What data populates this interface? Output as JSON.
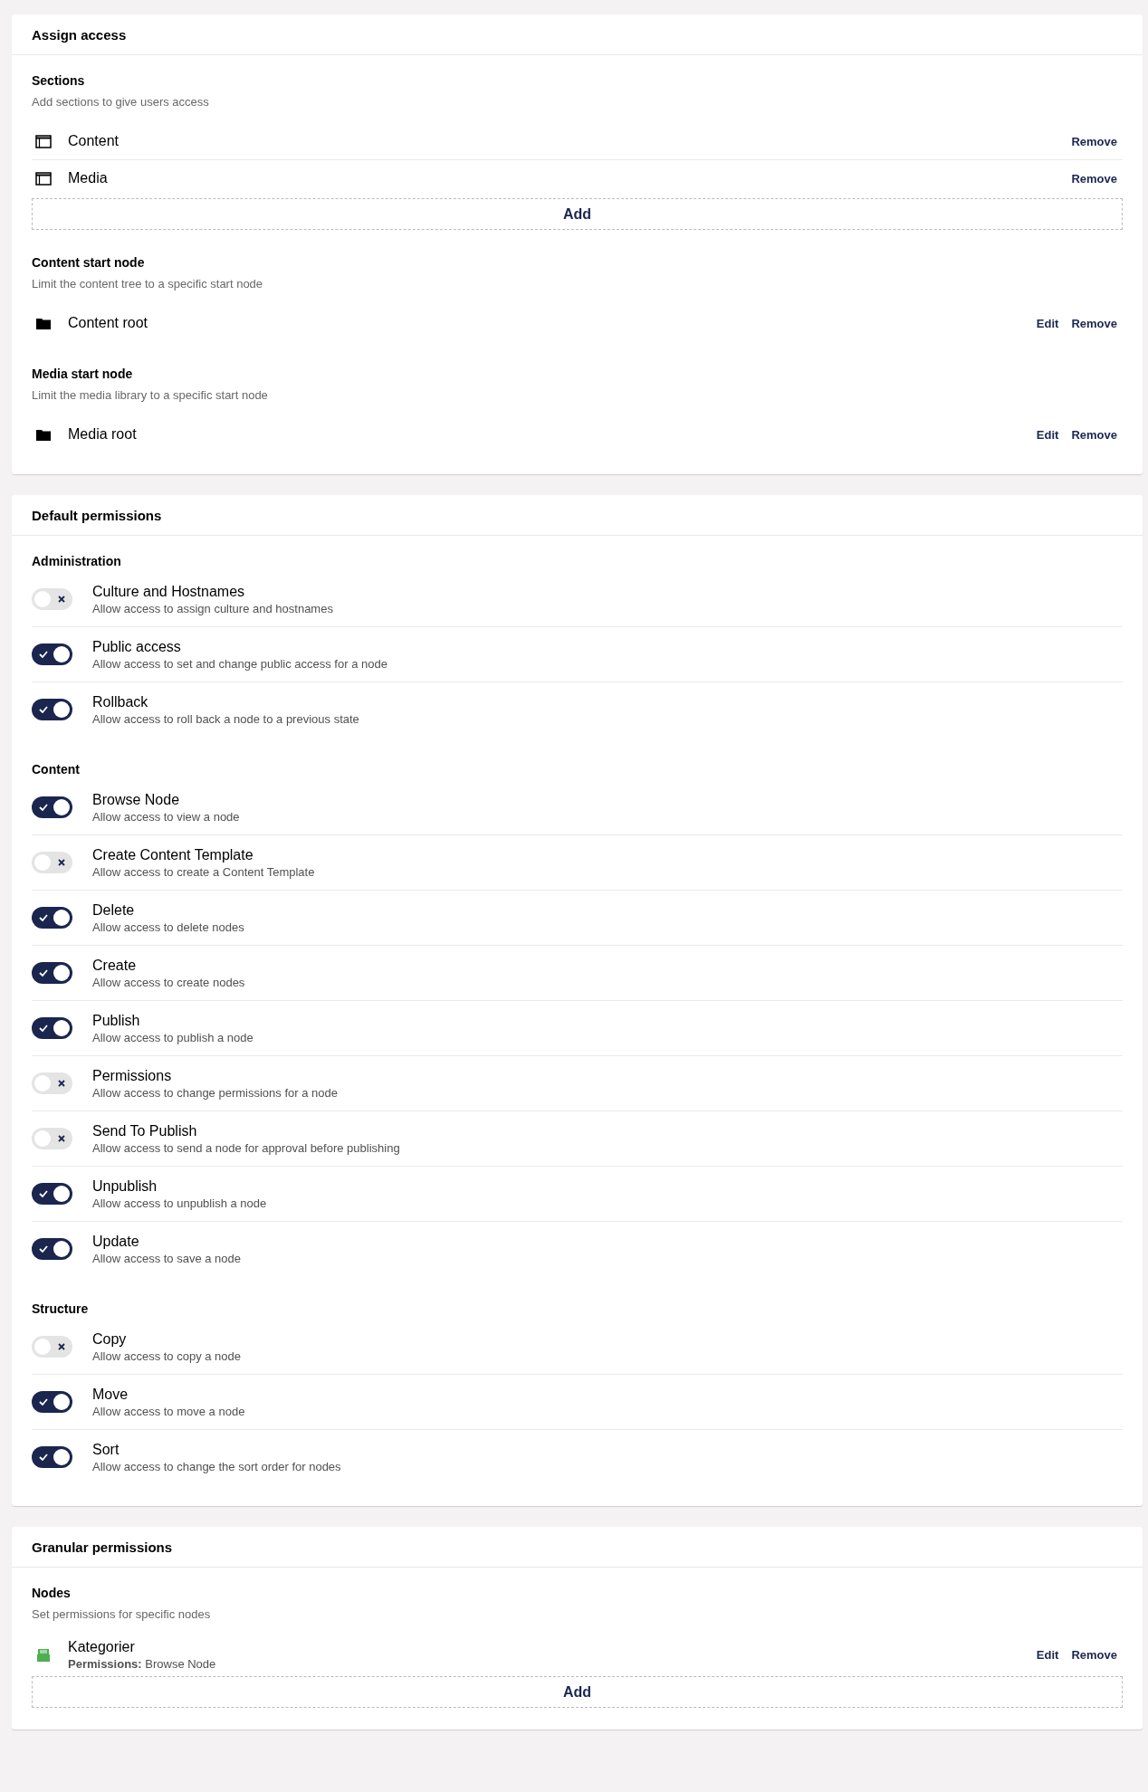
{
  "cards": [
    {
      "title": "Assign access",
      "blocks": [
        {
          "kind": "sections",
          "label": "Sections",
          "description": "Add sections to give users access",
          "items": [
            {
              "name": "Content",
              "actions": [
                "Remove"
              ]
            },
            {
              "name": "Media",
              "actions": [
                "Remove"
              ]
            }
          ],
          "add": "Add"
        },
        {
          "kind": "start_node",
          "label": "Content start node",
          "description": "Limit the content tree to a specific start node",
          "items": [
            {
              "name": "Content root",
              "actions": [
                "Edit",
                "Remove"
              ]
            }
          ]
        },
        {
          "kind": "start_node",
          "label": "Media start node",
          "description": "Limit the media library to a specific start node",
          "items": [
            {
              "name": "Media root",
              "actions": [
                "Edit",
                "Remove"
              ]
            }
          ]
        }
      ]
    },
    {
      "title": "Default permissions",
      "blocks": [
        {
          "kind": "toggles",
          "label": "Administration",
          "items": [
            {
              "name": "Culture and Hostnames",
              "description": "Allow access to assign culture and hostnames",
              "on": false
            },
            {
              "name": "Public access",
              "description": "Allow access to set and change public access for a node",
              "on": true
            },
            {
              "name": "Rollback",
              "description": "Allow access to roll back a node to a previous state",
              "on": true
            }
          ]
        },
        {
          "kind": "toggles",
          "label": "Content",
          "items": [
            {
              "name": "Browse Node",
              "description": "Allow access to view a node",
              "on": true
            },
            {
              "name": "Create Content Template",
              "description": "Allow access to create a Content Template",
              "on": false
            },
            {
              "name": "Delete",
              "description": "Allow access to delete nodes",
              "on": true
            },
            {
              "name": "Create",
              "description": "Allow access to create nodes",
              "on": true
            },
            {
              "name": "Publish",
              "description": "Allow access to publish a node",
              "on": true
            },
            {
              "name": "Permissions",
              "description": "Allow access to change permissions for a node",
              "on": false
            },
            {
              "name": "Send To Publish",
              "description": "Allow access to send a node for approval before publishing",
              "on": false
            },
            {
              "name": "Unpublish",
              "description": "Allow access to unpublish a node",
              "on": true
            },
            {
              "name": "Update",
              "description": "Allow access to save a node",
              "on": true
            }
          ]
        },
        {
          "kind": "toggles",
          "label": "Structure",
          "items": [
            {
              "name": "Copy",
              "description": "Allow access to copy a node",
              "on": false
            },
            {
              "name": "Move",
              "description": "Allow access to move a node",
              "on": true
            },
            {
              "name": "Sort",
              "description": "Allow access to change the sort order for nodes",
              "on": true
            }
          ]
        }
      ]
    },
    {
      "title": "Granular permissions",
      "blocks": [
        {
          "kind": "nodes",
          "label": "Nodes",
          "description": "Set permissions for specific nodes",
          "items": [
            {
              "name": "Kategorier",
              "detail": "**Permissions:** Browse Node",
              "actions": [
                "Edit",
                "Remove"
              ]
            }
          ],
          "add": "Add"
        }
      ]
    }
  ]
}
